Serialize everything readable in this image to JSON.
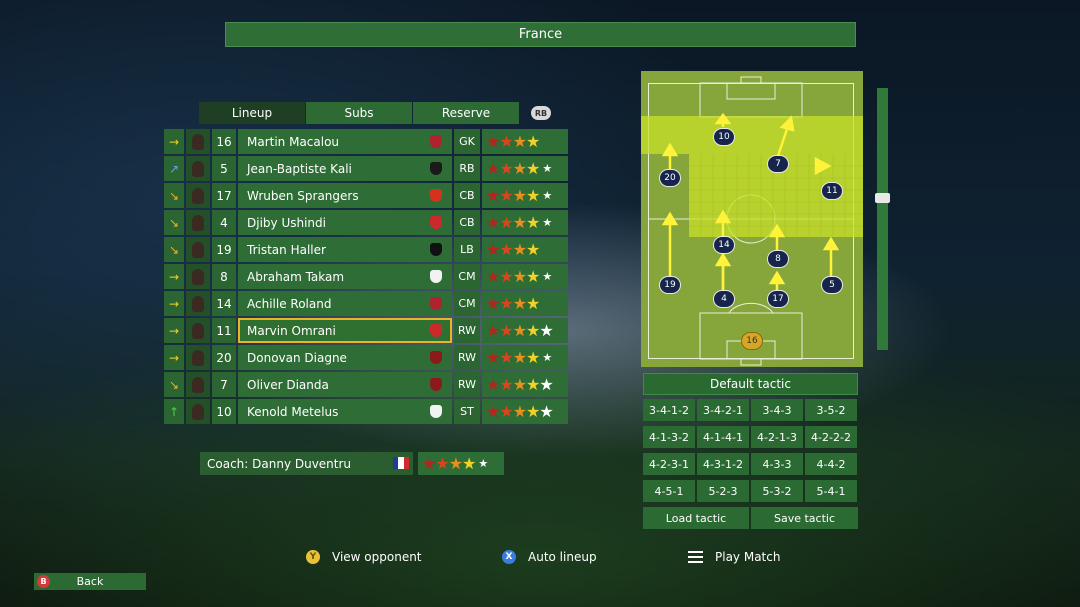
{
  "header": {
    "title": "France"
  },
  "tabs": [
    {
      "label": "Lineup",
      "active": true
    },
    {
      "label": "Subs",
      "active": false
    },
    {
      "label": "Reserve",
      "active": false
    }
  ],
  "tab_hint": "RB",
  "players": [
    {
      "arrow": "→",
      "arrow_color": "#f0d22a",
      "number": "16",
      "name": "Martin Macalou",
      "club_color": "#b0232e",
      "position": "GK",
      "stars": 4,
      "half": false,
      "selected": false
    },
    {
      "arrow": "↗",
      "arrow_color": "#6aa0e8",
      "number": "5",
      "name": "Jean-Baptiste Kali",
      "club_color": "#1a1a1a",
      "position": "RB",
      "stars": 4,
      "half": true,
      "selected": false
    },
    {
      "arrow": "↘",
      "arrow_color": "#f0b22a",
      "number": "17",
      "name": "Wruben Sprangers",
      "club_color": "#d2331c",
      "position": "CB",
      "stars": 4,
      "half": true,
      "selected": false
    },
    {
      "arrow": "↘",
      "arrow_color": "#f0b22a",
      "number": "4",
      "name": "Djiby Ushindi",
      "club_color": "#cc2a2a",
      "position": "CB",
      "stars": 4,
      "half": true,
      "selected": false
    },
    {
      "arrow": "↘",
      "arrow_color": "#f0b22a",
      "number": "19",
      "name": "Tristan Haller",
      "club_color": "#111111",
      "position": "LB",
      "stars": 4,
      "half": false,
      "selected": false
    },
    {
      "arrow": "→",
      "arrow_color": "#f0d22a",
      "number": "8",
      "name": "Abraham Takam",
      "club_color": "#f2f2f2",
      "position": "CM",
      "stars": 4,
      "half": true,
      "selected": false
    },
    {
      "arrow": "→",
      "arrow_color": "#f0d22a",
      "number": "14",
      "name": "Achille Roland",
      "club_color": "#b0232e",
      "position": "CM",
      "stars": 4,
      "half": false,
      "selected": false
    },
    {
      "arrow": "→",
      "arrow_color": "#f0d22a",
      "number": "11",
      "name": "Marvin Omrani",
      "club_color": "#cc2a2a",
      "position": "RW",
      "stars": 5,
      "half": false,
      "selected": true
    },
    {
      "arrow": "→",
      "arrow_color": "#f0d22a",
      "number": "20",
      "name": "Donovan Diagne",
      "club_color": "#8b1a1a",
      "position": "RW",
      "stars": 4,
      "half": true,
      "selected": false
    },
    {
      "arrow": "↘",
      "arrow_color": "#f0b22a",
      "number": "7",
      "name": "Oliver Dianda",
      "club_color": "#8b1a1a",
      "position": "RW",
      "stars": 5,
      "half": false,
      "selected": false
    },
    {
      "arrow": "↑",
      "arrow_color": "#4cd04c",
      "number": "10",
      "name": "Kenold Metelus",
      "club_color": "#f2f2f2",
      "position": "ST",
      "stars": 5,
      "half": false,
      "selected": false
    }
  ],
  "coach": {
    "label": "Coach: Danny Duventru",
    "stars": 4,
    "half": true
  },
  "formation_tokens": [
    "10",
    "7",
    "20",
    "11",
    "14",
    "8",
    "19",
    "4",
    "17",
    "5",
    "16"
  ],
  "tactics": {
    "default_label": "Default tactic",
    "options": [
      "3-4-1-2",
      "3-4-2-1",
      "3-4-3",
      "3-5-2",
      "4-1-3-2",
      "4-1-4-1",
      "4-2-1-3",
      "4-2-2-2",
      "4-2-3-1",
      "4-3-1-2",
      "4-3-3",
      "4-4-2",
      "4-5-1",
      "5-2-3",
      "5-3-2",
      "5-4-1"
    ],
    "load_label": "Load tactic",
    "save_label": "Save tactic"
  },
  "hints": {
    "view_opponent": {
      "key": "Y",
      "label": "View opponent"
    },
    "auto_lineup": {
      "key": "X",
      "label": "Auto lineup"
    },
    "play_match": {
      "label": "Play Match"
    }
  },
  "back": {
    "key": "B",
    "label": "Back"
  },
  "colors": {
    "panel_green": "#2e6d35",
    "highlight": "#e6b627",
    "pitch": "#86a53a"
  }
}
